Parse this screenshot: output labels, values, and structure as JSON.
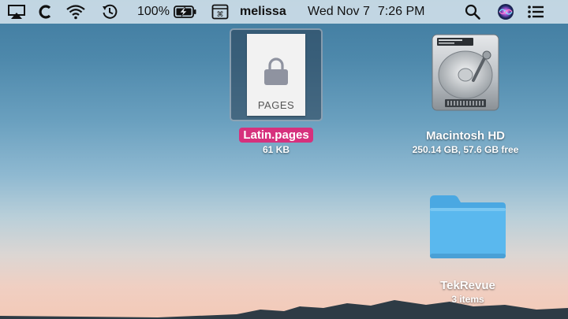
{
  "menubar": {
    "icons": [
      "airplay-icon",
      "c-app-icon",
      "wifi-icon",
      "time-machine-icon",
      "battery-charging-icon",
      "keyboard-menu-icon",
      "search-icon",
      "siri-icon",
      "notification-center-icon"
    ],
    "battery_percent": "100%",
    "battery_level": 1.0,
    "user_name": "melissa",
    "date": "Wed Nov 7",
    "time": "7:26 PM"
  },
  "desktop": {
    "file": {
      "name": "Latin.pages",
      "size": "61 KB",
      "doc_label": "PAGES",
      "icon": "pages-document-icon",
      "badge_color": "#d6317d"
    },
    "drive": {
      "name": "Macintosh HD",
      "info": "250.14 GB, 57.6 GB free",
      "icon": "hard-drive-icon"
    },
    "folder": {
      "name": "TekRevue",
      "info": "3 items",
      "icon": "folder-icon",
      "color": "#5ab8ee"
    }
  }
}
